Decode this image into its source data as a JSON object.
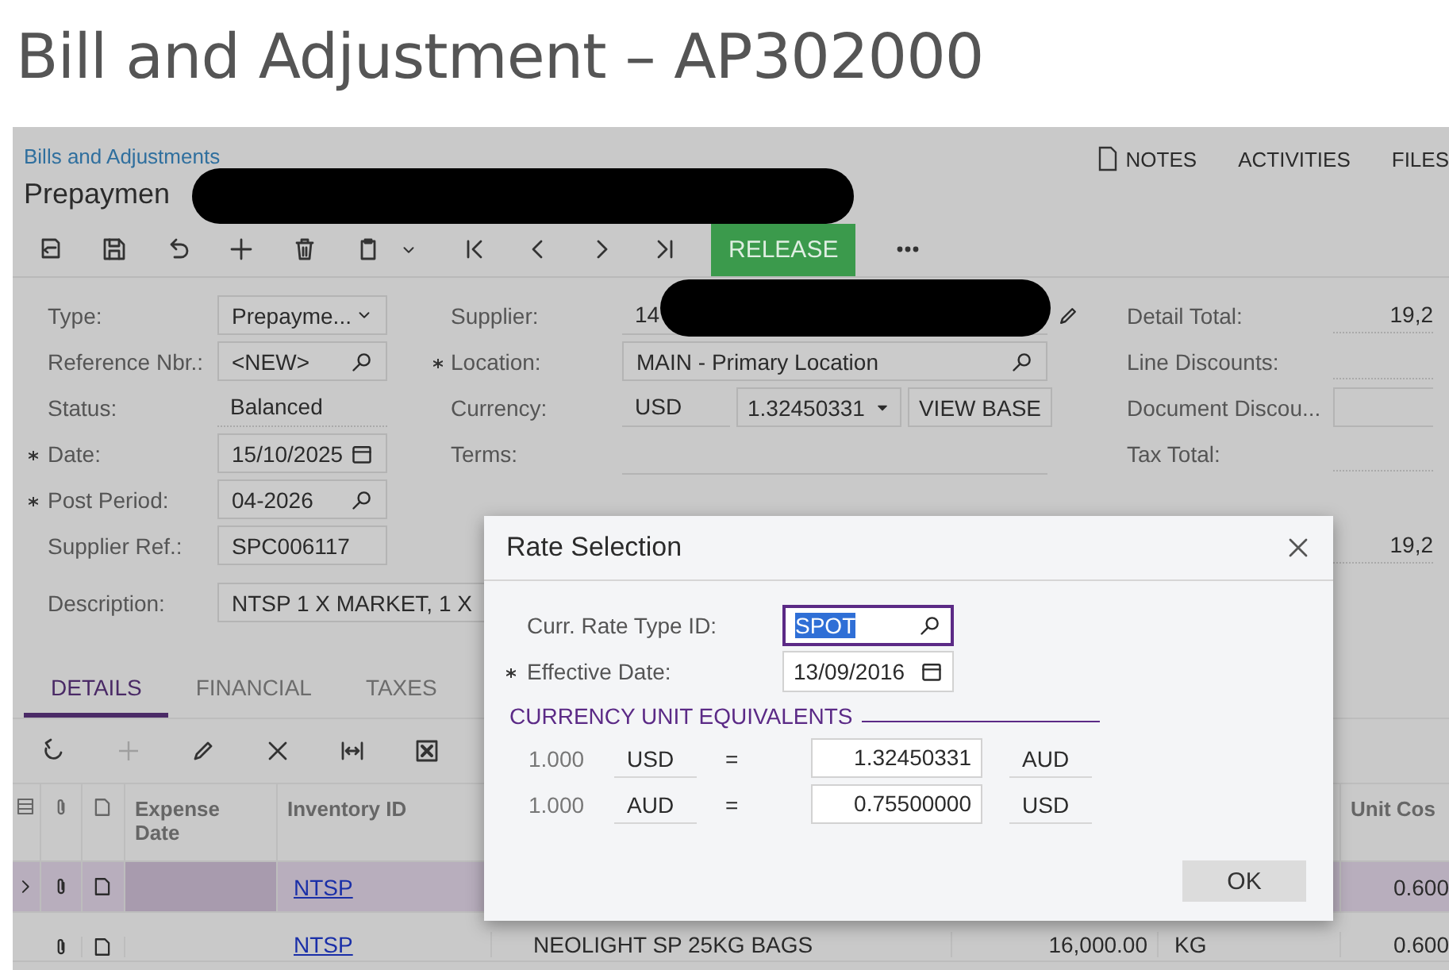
{
  "page_title": "Bill and Adjustment – AP302000",
  "breadcrumb": "Bills and Adjustments",
  "document_title": {
    "text": "Prepaymen",
    "redacted": true
  },
  "header_links": [
    "NOTES",
    "ACTIVITIES",
    "FILES"
  ],
  "release_button": "RELEASE",
  "form_left": [
    {
      "label": "Type:",
      "kind": "select",
      "value": "Prepayme...",
      "required": false
    },
    {
      "label": "Reference Nbr.:",
      "kind": "lookup",
      "value": "<NEW>",
      "required": false
    },
    {
      "label": "Status:",
      "kind": "plain",
      "value": "Balanced",
      "required": false
    },
    {
      "label": "Date:",
      "kind": "date",
      "value": "15/10/2025",
      "required": true
    },
    {
      "label": "Post Period:",
      "kind": "lookup",
      "value": "04-2026",
      "required": true
    },
    {
      "label": "Supplier Ref.:",
      "kind": "text",
      "value": "SPC006117",
      "required": false
    }
  ],
  "form_middle": [
    {
      "label": "Supplier:",
      "kind": "supplier",
      "value": "14",
      "redacted": true,
      "required": false
    },
    {
      "label": "Location:",
      "kind": "lookup",
      "value": "MAIN - Primary Location",
      "required": true
    },
    {
      "label": "Currency:",
      "kind": "currency",
      "value": "USD",
      "rate": "1.32450331",
      "button": "VIEW BASE",
      "required": false
    },
    {
      "label": "Terms:",
      "kind": "line",
      "required": false
    }
  ],
  "description": {
    "label": "Description:",
    "value": "NTSP 1 X MARKET, 1 X"
  },
  "totals": [
    {
      "label": "Detail Total:",
      "kind": "value",
      "value": "19,2"
    },
    {
      "label": "Line Discounts:",
      "kind": "blank"
    },
    {
      "label": "Document Discou...",
      "kind": "input"
    },
    {
      "label": "Tax Total:",
      "kind": "blank"
    },
    {
      "kind": "value",
      "value": "19,2"
    }
  ],
  "tabs": [
    {
      "label": "DETAILS",
      "selected": true
    },
    {
      "label": "FINANCIAL",
      "selected": false
    },
    {
      "label": "TAXES",
      "selected": false
    }
  ],
  "grid_toolbar": {
    "add_disabled": true
  },
  "columns": [
    "Expense Date",
    "Inventory ID",
    "Unit Cos"
  ],
  "rows": [
    {
      "selected": true,
      "inventory_id": "NTSP",
      "unit_cost": "0.600"
    },
    {
      "selected": false,
      "inventory_id": "NTSP",
      "description": "NEOLIGHT SP 25KG BAGS",
      "quantity": "16,000.00",
      "uom": "KG",
      "unit_cost": "0.600"
    }
  ],
  "dialog": {
    "title": "Rate Selection",
    "fields": [
      {
        "label": "Curr. Rate Type ID:",
        "kind": "lookup",
        "value": "SPOT",
        "required": false,
        "focused": true
      },
      {
        "label": "Effective Date:",
        "kind": "date",
        "value": "13/09/2016",
        "required": true,
        "focused": false
      }
    ],
    "section": "CURRENCY UNIT EQUIVALENTS",
    "equivalents": [
      {
        "amount": "1.000",
        "from": "USD",
        "sign": "=",
        "rate": "1.32450331",
        "to": "AUD"
      },
      {
        "amount": "1.000",
        "from": "AUD",
        "sign": "=",
        "rate": "0.75500000",
        "to": "USD"
      }
    ],
    "ok_button": "OK"
  }
}
